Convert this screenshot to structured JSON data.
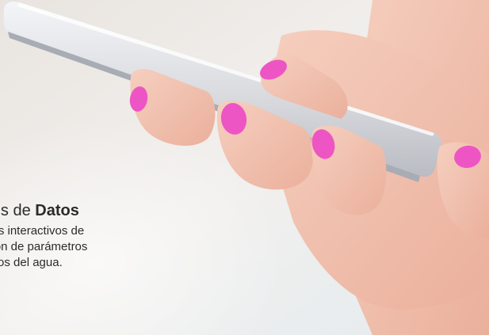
{
  "caption": {
    "heading_prefix": "isis de ",
    "heading_bold": "Datos",
    "body_lines": [
      "cos interactivos de",
      "ción de parámetros",
      "ticos del agua."
    ]
  },
  "colors": {
    "background": "#ece9e6",
    "phone": "#d7d8dd",
    "skin": "#f1c2b0",
    "nail": "#ee55c4",
    "text": "#2b2b2b"
  }
}
